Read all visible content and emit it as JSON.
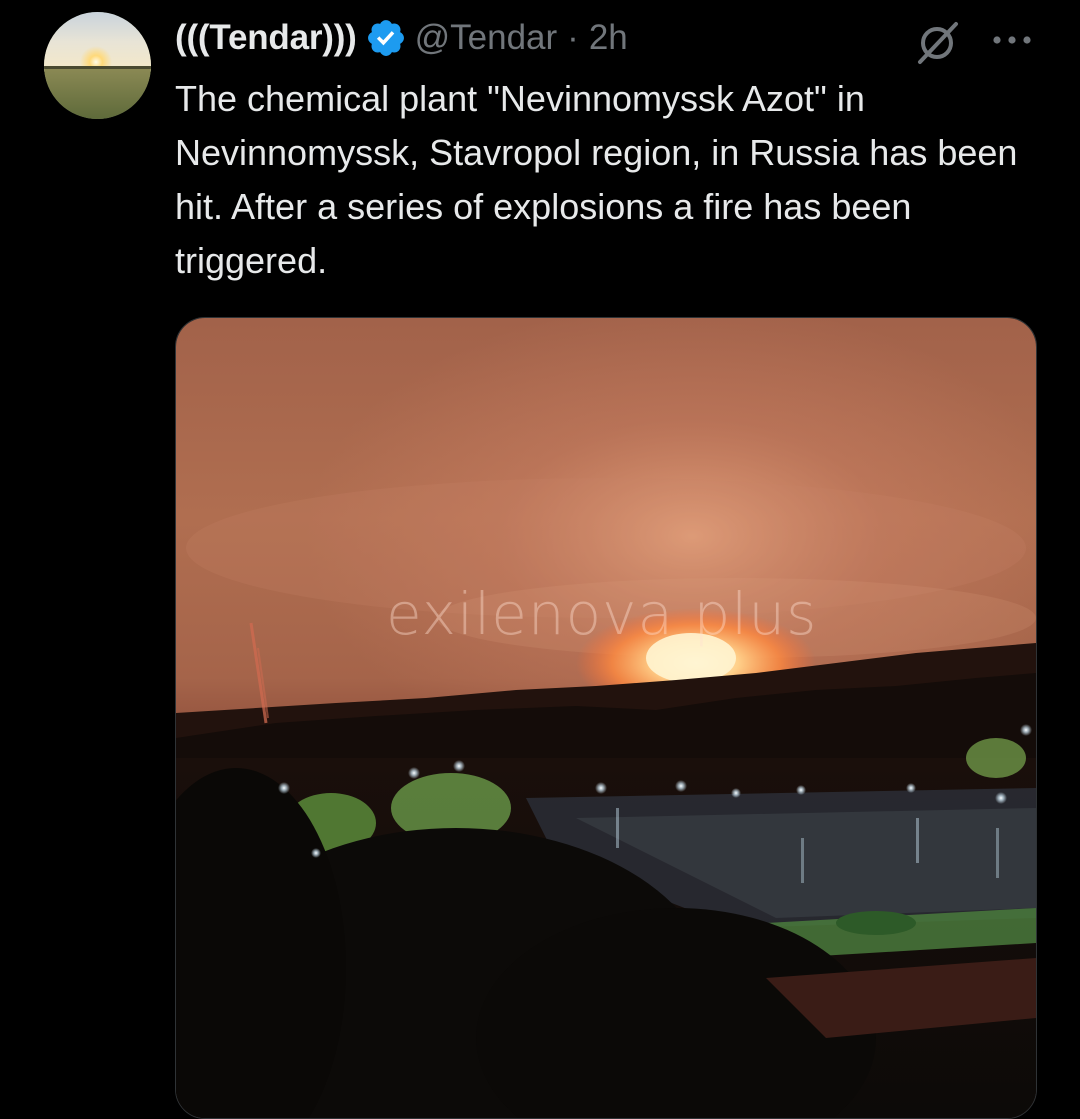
{
  "tweet": {
    "author": {
      "display_name": "(((Tendar)))",
      "handle": "@Tendar",
      "separator": "·",
      "time": "2h",
      "verified": true
    },
    "text": "The chemical plant \"Nevinnomyssk Azot\" in Nevinnomyssk, Stavropol region, in Russia has been hit. After a series of explosions a fire has been triggered.",
    "media": {
      "type": "video",
      "watermark": "exilenova plus"
    }
  },
  "icons": {
    "verified": "verified-badge-icon",
    "grok": "grok-icon",
    "more": "more-options-icon"
  },
  "colors": {
    "background": "#000000",
    "text_primary": "#e7e9ea",
    "text_secondary": "#71767b",
    "verified_blue": "#1d9bf0"
  }
}
